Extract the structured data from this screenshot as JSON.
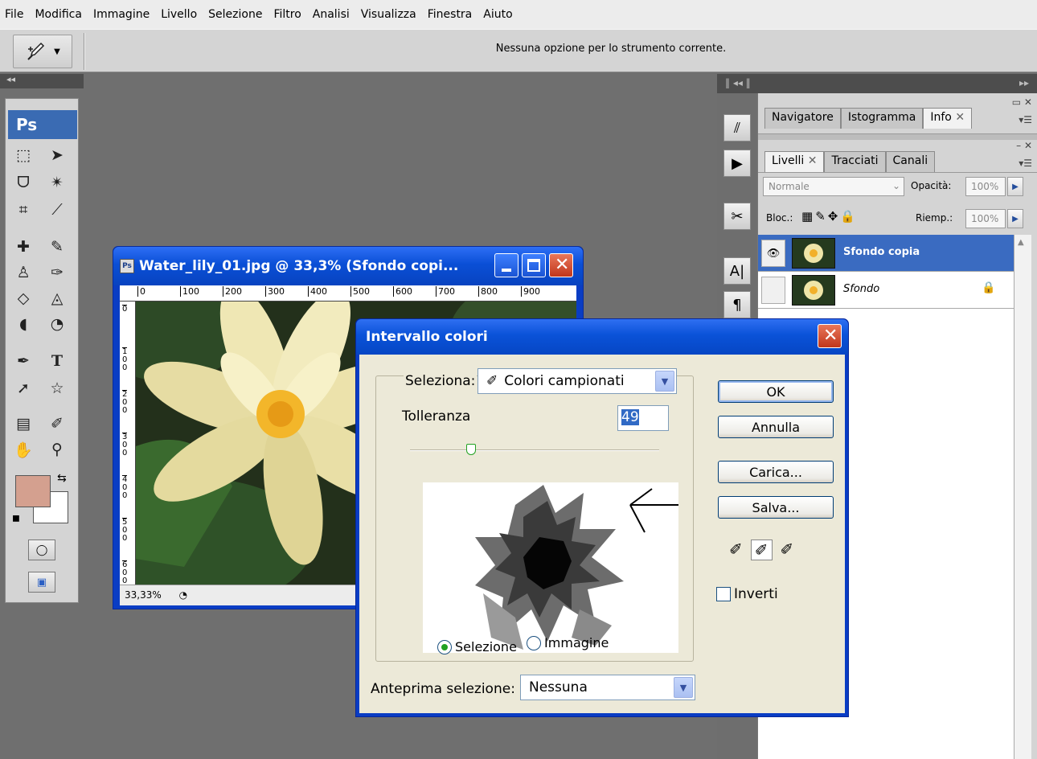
{
  "menu": [
    "File",
    "Modifica",
    "Immagine",
    "Livello",
    "Selezione",
    "Filtro",
    "Analisi",
    "Visualizza",
    "Finestra",
    "Aiuto"
  ],
  "options_bar": {
    "message": "Nessuna opzione per lo strumento corrente."
  },
  "toolbox": {
    "logo": "Ps"
  },
  "document": {
    "title": "Water_lily_01.jpg @ 33,3% (Sfondo copi...",
    "zoom": "33,33%",
    "ruler_top": [
      "0",
      "100",
      "200",
      "300",
      "400",
      "500",
      "600",
      "700",
      "800",
      "900"
    ],
    "ruler_left": [
      "0",
      "1\n0\n0",
      "2\n0\n0",
      "3\n0\n0",
      "4\n0\n0",
      "5\n0\n0",
      "6\n0\n0"
    ]
  },
  "panels": {
    "top_tabs": [
      "Navigatore",
      "Istogramma",
      "Info"
    ],
    "layer_tabs": [
      "Livelli",
      "Tracciati",
      "Canali"
    ],
    "blend_mode": "Normale",
    "opacity_label": "Opacità:",
    "opacity_value": "100%",
    "lock_label": "Bloc.:",
    "fill_label": "Riemp.:",
    "fill_value": "100%",
    "layers": [
      {
        "name": "Sfondo copia",
        "visible": true,
        "selected": true
      },
      {
        "name": "Sfondo",
        "visible": false,
        "selected": false
      }
    ]
  },
  "dialog": {
    "title": "Intervallo colori",
    "select_label": "Seleziona:",
    "select_value": "Colori campionati",
    "tolerance_label": "Tolleranza",
    "tolerance_value": "49",
    "tolerance_fraction": 0.245,
    "radio_selection": "Selezione",
    "radio_image": "Immagine",
    "preview_label": "Anteprima selezione:",
    "preview_value": "Nessuna",
    "buttons": {
      "ok": "OK",
      "cancel": "Annulla",
      "load": "Carica...",
      "save": "Salva..."
    },
    "invert_label": "Inverti"
  },
  "colors": {
    "foreground": "#d4a08f",
    "background": "#ffffff",
    "accent": "#0a52d8"
  }
}
